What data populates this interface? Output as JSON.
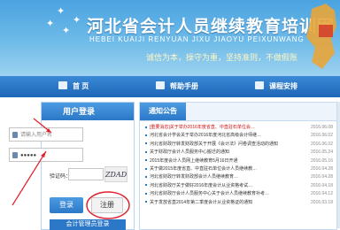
{
  "header": {
    "title": "河北省会计人员继续教育培训网",
    "subtitle": "HEBEI KUAIJI RENYUAN JIXU JIAOYU PEIXUNWANG",
    "slogan": "诚信为本，操守为重，坚持准则，不做假账"
  },
  "nav": {
    "items": [
      {
        "label": "首 页",
        "icon": "home-icon"
      },
      {
        "label": "帮助手册",
        "icon": "book-icon"
      },
      {
        "label": "课程安排",
        "icon": "calendar-icon"
      }
    ]
  },
  "login": {
    "title": "用户登录",
    "username_placeholder": "请输入用户名",
    "password_value": "●●●●●",
    "captcha_label": "验证码：",
    "captcha_text": "ZDAD",
    "login_button": "登录",
    "register_button": "注册",
    "bottom_button": "会计管理员登录"
  },
  "notice": {
    "tab": "通知公告",
    "items": [
      {
        "title": "[重要消息]关于举办2016年度省直、中直驻石单位会…",
        "date": "2016.06.08",
        "hot": true
      },
      {
        "title": "河北省会计学会关于举办2016年度河北省高级会计师继…",
        "date": "2016.06.02",
        "hot": false
      },
      {
        "title": "河北省财政厅转发财政部关于开展《会计法》问卷调查活动的通知",
        "date": "2016.06.02",
        "hot": false
      },
      {
        "title": "关于财政厅会计人员服务中心搬迁的通知",
        "date": "2016.05.24",
        "hot": false
      },
      {
        "title": "2015年度会计人员网上继续教育5月16日开通",
        "date": "2016.05.16",
        "hot": false
      },
      {
        "title": "关于做2015年度省直、中直驻石单位会计人员继续教…",
        "date": "2016.04.28",
        "hot": false
      },
      {
        "title": "河北省财政厅转发财政部会计人员继续教育…",
        "date": "2016.04.28",
        "hot": false
      },
      {
        "title": "河北省财政厅关于做好2016年度会计从业资格考试…",
        "date": "2016.04.18",
        "hot": false
      },
      {
        "title": "河北省财政厅会计人员服务中心关于会计人员继续教育补考…",
        "date": "2016.04.12",
        "hot": false
      },
      {
        "title": "关于发放省直2014年第二季度会计从业资格证的通知",
        "date": "2016.03.18",
        "hot": false
      }
    ]
  },
  "colors": {
    "brand_blue": "#2b78c8",
    "annotation_red": "#e0202a"
  }
}
